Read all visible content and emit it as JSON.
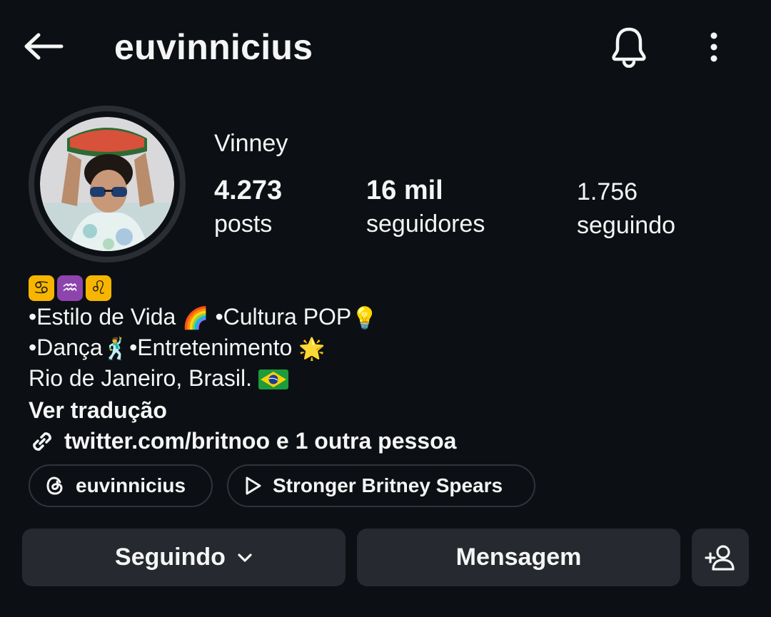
{
  "header": {
    "username": "euvinnicius"
  },
  "profile": {
    "display_name": "Vinney",
    "stats": {
      "posts_count": "4.273",
      "posts_label": "posts",
      "followers_count": "16 mil",
      "followers_label": "seguidores",
      "following_count": "1.756",
      "following_label": "seguindo"
    }
  },
  "bio": {
    "line1": " •Estilo de Vida",
    "line1b": " •Cultura POP",
    "line2": "•Dança",
    "line2b": "•Entretenimento",
    "line3": "Rio de Janeiro, Brasil.",
    "translate_label": "Ver tradução",
    "link_text": "twitter.com/britnoo e 1 outra pessoa"
  },
  "pills": {
    "threads_label": "euvinnicius",
    "music_label": "Stronger Britney Spears"
  },
  "actions": {
    "following_label": "Seguindo",
    "message_label": "Mensagem"
  },
  "icons": {
    "back": "arrow-left-icon",
    "bell": "bell-icon",
    "menu": "more-vertical-icon",
    "link": "link-icon",
    "threads": "threads-icon",
    "play": "play-icon",
    "chevron": "chevron-down-icon",
    "add_user": "add-user-icon"
  },
  "colors": {
    "background": "#0c1014",
    "text": "#f5f5f5",
    "button_bg": "#262a30",
    "pill_border": "#2f343a"
  }
}
